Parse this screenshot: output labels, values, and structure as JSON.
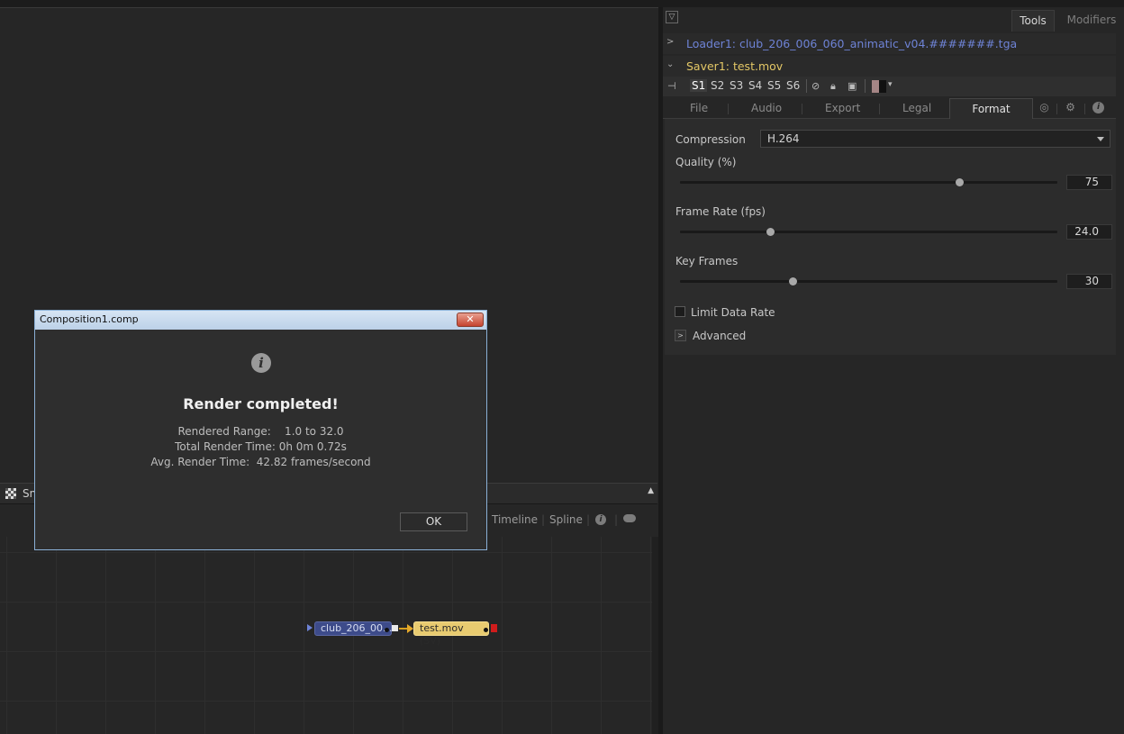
{
  "viewer": {
    "bar_label": "Sn",
    "node_tabs": [
      "Timeline",
      "Spline"
    ]
  },
  "nodes": {
    "loader_label": "club_206_00...",
    "saver_label": "test.mov  (SV)"
  },
  "inspector": {
    "top_tabs": [
      "Tools",
      "Modifiers"
    ],
    "loader_row": "Loader1: club_206_006_060_animatic_v04.#######.tga",
    "saver_row": "Saver1: test.mov",
    "versions": [
      "S1",
      "S2",
      "S3",
      "S4",
      "S5",
      "S6"
    ],
    "control_tabs": [
      "File",
      "Audio",
      "Export",
      "Legal",
      "Format"
    ],
    "active_control_tab": "Format",
    "compression_label": "Compression",
    "compression_value": "H.264",
    "quality_label": "Quality (%)",
    "quality_value": "75",
    "quality_fraction": 0.74,
    "framerate_label": "Frame Rate (fps)",
    "framerate_value": "24.0",
    "framerate_fraction": 0.24,
    "keyframes_label": "Key Frames",
    "keyframes_value": "30",
    "keyframes_fraction": 0.3,
    "limit_label": "Limit Data Rate",
    "advanced_label": "Advanced",
    "color_swatch": "#a58585"
  },
  "dialog": {
    "title": "Composition1.comp",
    "close_label": "✕",
    "heading": "Render completed!",
    "line1": "Rendered Range:    1.0 to 32.0",
    "line2": "Total Render Time: 0h 0m 0.72s",
    "line3": "Avg. Render Time:  42.82 frames/second",
    "ok_label": "OK"
  }
}
